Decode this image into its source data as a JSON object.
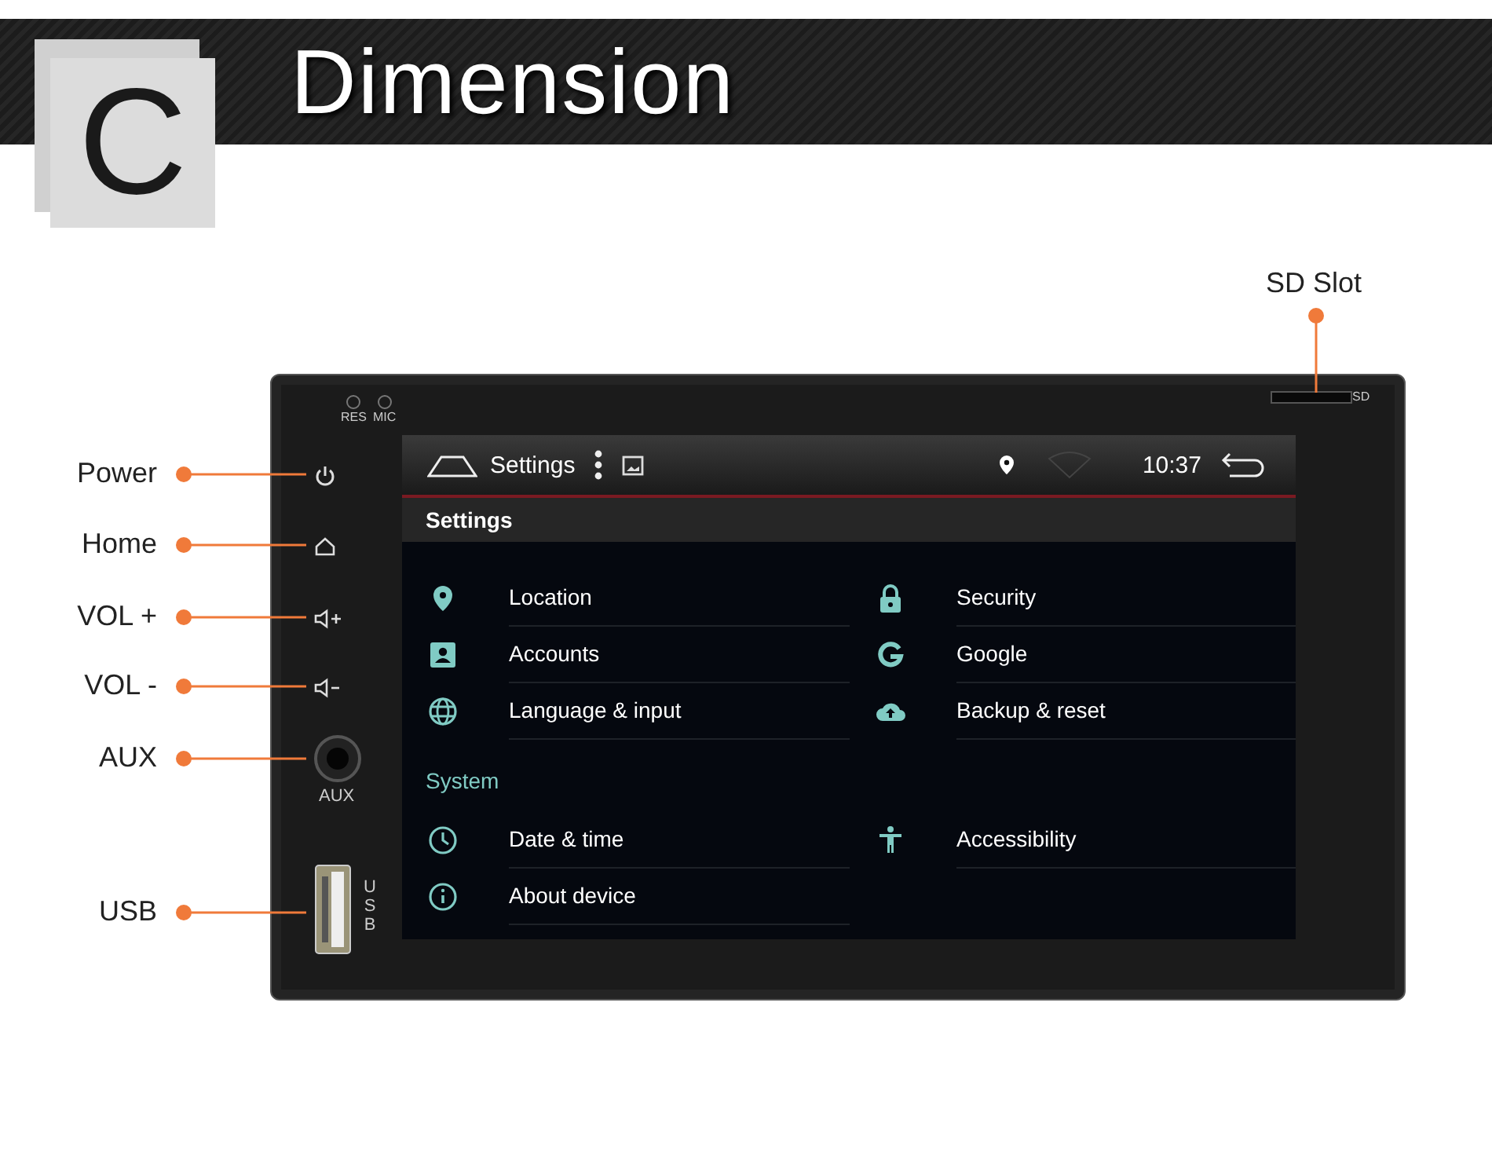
{
  "banner": {
    "letter": "C",
    "title": "Dimension"
  },
  "sd_slot": {
    "label": "SD Slot",
    "port_label": "SD"
  },
  "callouts": [
    {
      "label": "Power"
    },
    {
      "label": "Home"
    },
    {
      "label": "VOL +"
    },
    {
      "label": "VOL -"
    },
    {
      "label": "AUX"
    },
    {
      "label": "USB"
    }
  ],
  "device": {
    "indicators": [
      "RES",
      "MIC"
    ],
    "aux_label": "AUX",
    "usb_label": "USB"
  },
  "screen": {
    "status_bar": {
      "title": "Settings",
      "time": "10:37"
    },
    "app_bar": {
      "title": "Settings"
    },
    "sections": [
      {
        "items": [
          {
            "label": "Location"
          },
          {
            "label": "Security"
          },
          {
            "label": "Accounts"
          },
          {
            "label": "Google"
          },
          {
            "label": "Language & input"
          },
          {
            "label": "Backup & reset"
          }
        ]
      },
      {
        "header": "System",
        "items": [
          {
            "label": "Date & time"
          },
          {
            "label": "Accessibility"
          },
          {
            "label": "About device"
          }
        ]
      }
    ]
  }
}
